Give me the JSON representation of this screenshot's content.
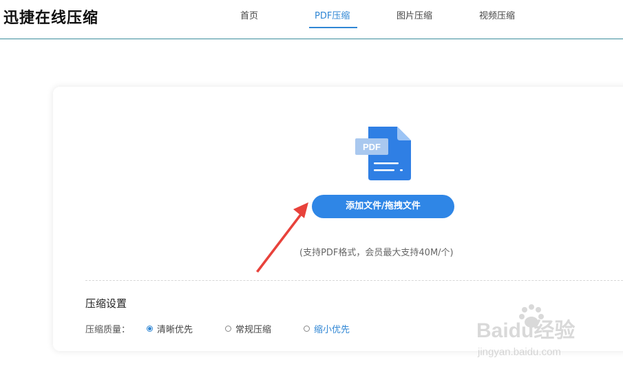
{
  "header": {
    "logo": "迅捷在线压缩",
    "nav": [
      {
        "label": "首页",
        "active": false
      },
      {
        "label": "PDF压缩",
        "active": true
      },
      {
        "label": "图片压缩",
        "active": false
      },
      {
        "label": "视频压缩",
        "active": false
      }
    ]
  },
  "upload": {
    "icon": "pdf-file-icon",
    "icon_badge": "PDF",
    "button_label": "添加文件/拖拽文件",
    "hint": "(支持PDF格式，会员最大支持40M/个)"
  },
  "settings": {
    "title": "压缩设置",
    "quality_label": "压缩质量：",
    "options": [
      {
        "label": "清晰优先",
        "checked": true
      },
      {
        "label": "常规压缩",
        "checked": false
      },
      {
        "label": "缩小优先",
        "checked": false
      }
    ]
  },
  "watermark": {
    "brand": "Baidu经验",
    "url": "jingyan.baidu.com"
  },
  "colors": {
    "accent": "#2f86d4",
    "button": "#2f86e6",
    "header_line": "#3a8c9c",
    "arrow": "#e8423b"
  }
}
